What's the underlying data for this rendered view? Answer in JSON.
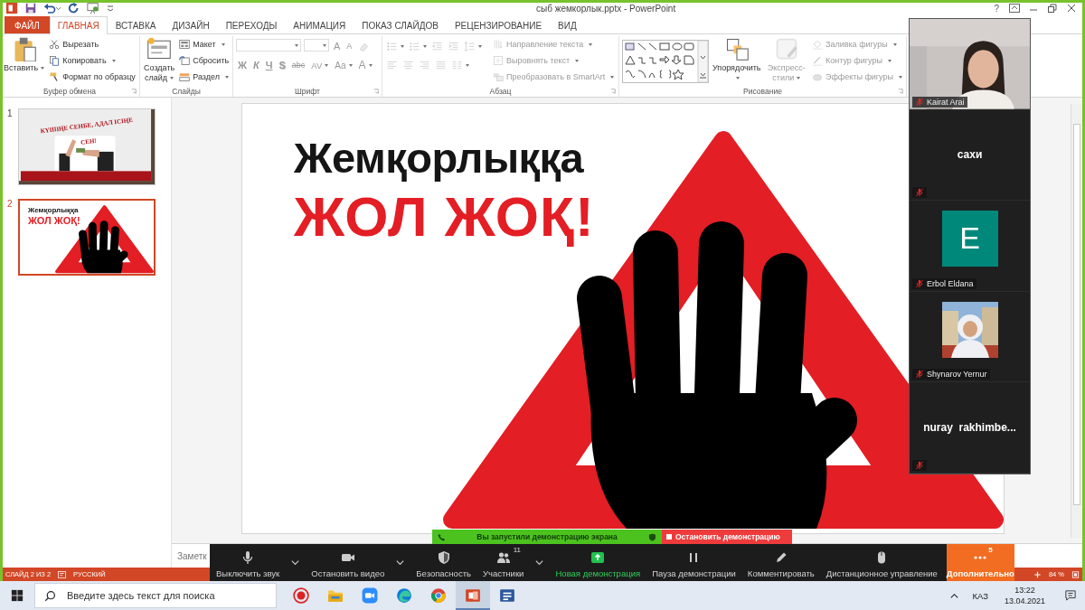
{
  "title_bar": {
    "title": "сыб жемкорлык.pptx - PowerPoint",
    "help": "?"
  },
  "ribbon_tabs": [
    {
      "label": "ФАЙЛ",
      "kind": "file",
      "selected": false
    },
    {
      "label": "ГЛАВНАЯ",
      "kind": "tab",
      "selected": true
    },
    {
      "label": "ВСТАВКА",
      "kind": "tab",
      "selected": false
    },
    {
      "label": "ДИЗАЙН",
      "kind": "tab",
      "selected": false
    },
    {
      "label": "ПЕРЕХОДЫ",
      "kind": "tab",
      "selected": false
    },
    {
      "label": "АНИМАЦИЯ",
      "kind": "tab",
      "selected": false
    },
    {
      "label": "ПОКАЗ СЛАЙДОВ",
      "kind": "tab",
      "selected": false
    },
    {
      "label": "РЕЦЕНЗИРОВАНИЕ",
      "kind": "tab",
      "selected": false
    },
    {
      "label": "ВИД",
      "kind": "tab",
      "selected": false
    }
  ],
  "ribbon_groups": [
    {
      "label": "Буфер обмена",
      "launcher": true,
      "items": [
        {
          "kind": "large",
          "label": "Вставить",
          "dropdown": true,
          "disabled": false
        },
        {
          "kind": "small",
          "label": "Вырезать",
          "dropdown": false,
          "disabled": false
        },
        {
          "kind": "small",
          "label": "Копировать",
          "dropdown": true,
          "disabled": false
        },
        {
          "kind": "small",
          "label": "Формат по образцу",
          "dropdown": false,
          "disabled": false
        }
      ]
    },
    {
      "label": "Слайды",
      "launcher": false,
      "items": [
        {
          "kind": "large",
          "label": "Создать слайд",
          "dropdown": true,
          "disabled": false
        },
        {
          "kind": "small",
          "label": "Макет",
          "dropdown": true,
          "disabled": false
        },
        {
          "kind": "small",
          "label": "Сбросить",
          "dropdown": false,
          "disabled": false
        },
        {
          "kind": "small",
          "label": "Раздел",
          "dropdown": true,
          "disabled": false
        }
      ]
    },
    {
      "label": "Шрифт",
      "launcher": true,
      "items": [
        {
          "kind": "combo",
          "dropdown": true,
          "disabled": true
        },
        {
          "kind": "combo",
          "dropdown": true,
          "disabled": true
        },
        {
          "kind": "glyph",
          "label": "A",
          "dropdown": false,
          "disabled": true
        },
        {
          "kind": "glyph",
          "label": "A",
          "dropdown": false,
          "disabled": true
        },
        {
          "kind": "tool",
          "dropdown": false,
          "disabled": true
        },
        {
          "kind": "glyph",
          "label": "Ж",
          "dropdown": false,
          "disabled": true
        },
        {
          "kind": "glyph",
          "label": "К",
          "dropdown": false,
          "disabled": true
        },
        {
          "kind": "glyph",
          "label": "Ч",
          "dropdown": false,
          "disabled": true
        },
        {
          "kind": "glyph",
          "label": "S",
          "dropdown": false,
          "disabled": true
        },
        {
          "kind": "glyph",
          "label": "abc",
          "dropdown": false,
          "disabled": true
        },
        {
          "kind": "glyph",
          "label": "AV",
          "dropdown": true,
          "disabled": true
        },
        {
          "kind": "glyph",
          "label": "Aa",
          "dropdown": true,
          "disabled": true
        },
        {
          "kind": "glyph",
          "label": "A",
          "dropdown": true,
          "disabled": true
        }
      ]
    },
    {
      "label": "Абзац",
      "launcher": true,
      "items": [
        {
          "kind": "tool",
          "dropdown": true,
          "disabled": true
        },
        {
          "kind": "tool",
          "dropdown": true,
          "disabled": true
        },
        {
          "kind": "tool",
          "dropdown": false,
          "disabled": true
        },
        {
          "kind": "tool",
          "dropdown": false,
          "disabled": true
        },
        {
          "kind": "tool",
          "dropdown": true,
          "disabled": true
        },
        {
          "kind": "tool",
          "dropdown": false,
          "disabled": true
        },
        {
          "kind": "tool",
          "dropdown": false,
          "disabled": true
        },
        {
          "kind": "tool",
          "dropdown": false,
          "disabled": true
        },
        {
          "kind": "tool",
          "dropdown": false,
          "disabled": true
        },
        {
          "kind": "tool",
          "dropdown": true,
          "disabled": true
        },
        {
          "kind": "small",
          "label": "Направление текста",
          "dropdown": true,
          "disabled": true
        },
        {
          "kind": "small",
          "label": "Выровнять текст",
          "dropdown": true,
          "disabled": true
        },
        {
          "kind": "small",
          "label": "Преобразовать в SmartArt",
          "dropdown": true,
          "disabled": true
        }
      ]
    },
    {
      "label": "Рисование",
      "launcher": true,
      "items": [
        {
          "kind": "tool",
          "dropdown": false,
          "disabled": false
        },
        {
          "kind": "large",
          "label": "Упорядочить",
          "dropdown": true,
          "disabled": false
        },
        {
          "kind": "large",
          "label": "Экспресс-стили",
          "dropdown": true,
          "disabled": true
        },
        {
          "kind": "small",
          "label": "Заливка фигуры",
          "dropdown": true,
          "disabled": true
        },
        {
          "kind": "small",
          "label": "Контур фигуры",
          "dropdown": true,
          "disabled": true
        },
        {
          "kind": "small",
          "label": "Эффекты фигуры",
          "dropdown": true,
          "disabled": true
        }
      ]
    }
  ],
  "slides": [
    {
      "number": "1",
      "selected": false,
      "kind": "photo-title",
      "lines": [
        {
          "text": "КҮШІҢЕ СЕНБЕ, АДАЛ ІСІҢЕ СЕН!",
          "kind": "banner"
        }
      ]
    },
    {
      "number": "2",
      "selected": true,
      "kind": "stop-sign",
      "lines": [
        {
          "text": "Жемқорлыққа",
          "kind": "dark"
        },
        {
          "text": "ЖОЛ ЖОҚ!",
          "kind": "accent"
        }
      ]
    }
  ],
  "slide": {
    "kind": "stop-sign",
    "lines": [
      {
        "text": "Жемқорлыққа",
        "kind": "dark"
      },
      {
        "text": "ЖОЛ ЖОҚ!",
        "kind": "accent"
      }
    ]
  },
  "notes": {
    "placeholder": "Заметк"
  },
  "status_bar": {
    "slide": "СЛАЙД 2 ИЗ 2",
    "language": "РУССКИЙ",
    "zoom": "84 %"
  },
  "participants": [
    {
      "name": "Kairat Arai",
      "kind": "video",
      "muted": true
    },
    {
      "name": "сахи",
      "kind": "name",
      "muted": true
    },
    {
      "name": "Erbol Eldana",
      "kind": "avatar",
      "initial": "E",
      "muted": true
    },
    {
      "name": "Shynarov Yernur",
      "muted": true
    },
    {
      "name": "nuray  rakhimbe...",
      "kind": "name",
      "muted": true
    }
  ],
  "share_banner": {
    "message": "Вы запустили демонстрацию экрана",
    "stop": "Остановить демонстрацию"
  },
  "meeting_toolbar": [
    {
      "label": "Выключить звук",
      "kind": "normal",
      "caret": true
    },
    {
      "label": "Остановить видео",
      "kind": "normal",
      "caret": true
    },
    {
      "label": "Безопасность",
      "kind": "normal",
      "caret": false
    },
    {
      "label": "Участники",
      "kind": "normal",
      "count": "11",
      "caret": true
    },
    {
      "label": "Новая демонстрация",
      "kind": "share",
      "caret": false
    },
    {
      "label": "Пауза демонстрации",
      "kind": "normal",
      "caret": false
    },
    {
      "label": "Комментировать",
      "kind": "normal",
      "caret": false
    },
    {
      "label": "Дистанционное управление",
      "kind": "normal",
      "caret": false
    },
    {
      "label": "Дополнительно",
      "kind": "more",
      "count": "5",
      "caret": false
    }
  ],
  "taskbar": {
    "search_placeholder": "Введите здесь текст для поиска",
    "apps": [
      {
        "kind": "record",
        "active": false
      },
      {
        "kind": "folder",
        "active": false
      },
      {
        "kind": "camera",
        "active": false
      },
      {
        "kind": "swirl",
        "active": false
      },
      {
        "kind": "circle",
        "active": false
      },
      {
        "kind": "slides",
        "active": true
      },
      {
        "kind": "document",
        "active": false
      }
    ],
    "language": "КАЗ",
    "time": "13:22",
    "date": "13.04.2021"
  }
}
